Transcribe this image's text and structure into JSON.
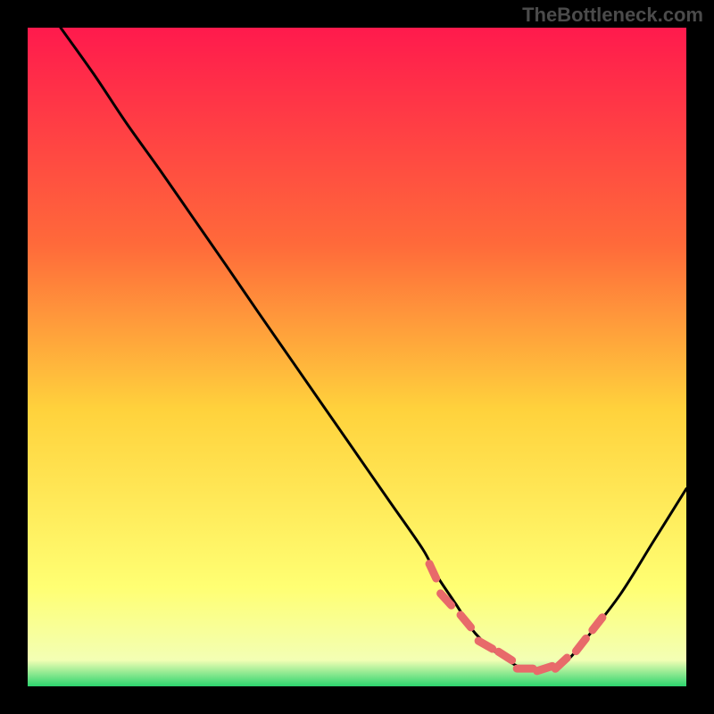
{
  "watermark": "TheBottleneck.com",
  "colors": {
    "frame": "#000000",
    "watermark": "#4b4b4b",
    "gradient_stops": [
      {
        "offset": 0,
        "color": "#ff1a4d"
      },
      {
        "offset": 33,
        "color": "#ff6a3a"
      },
      {
        "offset": 58,
        "color": "#ffd23c"
      },
      {
        "offset": 85,
        "color": "#ffff73"
      },
      {
        "offset": 96,
        "color": "#f3ffb4"
      },
      {
        "offset": 100,
        "color": "#2cd46e"
      }
    ],
    "curve": "#000000",
    "markers": "#e86a6a"
  },
  "chart_data": {
    "type": "line",
    "title": "",
    "xlabel": "",
    "ylabel": "",
    "xlim": [
      0,
      100
    ],
    "ylim": [
      0,
      100
    ],
    "series": [
      {
        "name": "bottleneck_curve",
        "x": [
          5,
          10,
          15,
          20,
          25,
          30,
          35,
          40,
          45,
          50,
          55,
          60,
          62,
          65,
          68,
          72,
          76,
          80,
          82,
          85,
          90,
          95,
          100
        ],
        "y": [
          100,
          93,
          85.5,
          78.5,
          71.3,
          64.1,
          56.8,
          49.6,
          42.4,
          35.2,
          28,
          20.8,
          17,
          12.5,
          8,
          4.5,
          2.5,
          3,
          4,
          7.5,
          14,
          22,
          30
        ]
      }
    ],
    "markers": {
      "name": "best_range",
      "style": "dashed",
      "x": [
        61.5,
        63.5,
        66.5,
        69.5,
        72.5,
        75.5,
        78.5,
        81,
        84,
        86.5
      ],
      "y": [
        17.5,
        13.2,
        9.9,
        6.3,
        4.6,
        2.7,
        2.7,
        3.5,
        6.3,
        9.5
      ]
    }
  }
}
